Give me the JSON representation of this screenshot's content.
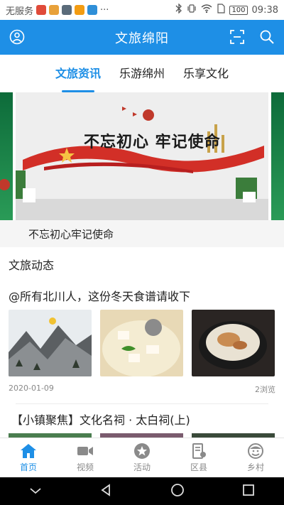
{
  "status": {
    "carrier": "无服务",
    "battery": "100",
    "time": "09:38",
    "dots": "···"
  },
  "header": {
    "title": "文旅绵阳"
  },
  "tabs": [
    {
      "label": "文旅资讯",
      "active": true
    },
    {
      "label": "乐游绵州",
      "active": false
    },
    {
      "label": "乐享文化",
      "active": false
    }
  ],
  "banner": {
    "slogan": "不忘初心 牢记使命",
    "caption": "不忘初心牢记使命"
  },
  "section": {
    "title": "文旅动态"
  },
  "articles": [
    {
      "title": "@所有北川人，这份冬天食谱请收下",
      "date": "2020-01-09",
      "views": "2浏览"
    },
    {
      "title": "【小镇聚焦】文化名祠 · 太白祠(上)"
    }
  ],
  "bottom_nav": [
    {
      "label": "首页",
      "icon": "home-icon",
      "active": true
    },
    {
      "label": "视频",
      "icon": "video-icon",
      "active": false
    },
    {
      "label": "活动",
      "icon": "star-icon",
      "active": false
    },
    {
      "label": "区县",
      "icon": "district-icon",
      "active": false
    },
    {
      "label": "乡村",
      "icon": "village-icon",
      "active": false
    }
  ],
  "colors": {
    "accent": "#1e8fe6",
    "inactive": "#8a8a8a"
  }
}
